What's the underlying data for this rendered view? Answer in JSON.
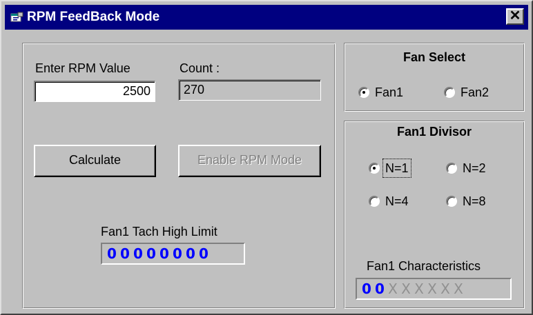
{
  "window": {
    "title": "RPM FeedBack Mode",
    "close_glyph": "✕"
  },
  "left_panel": {
    "rpm_label": "Enter RPM Value",
    "rpm_value": "2500",
    "count_label": "Count :",
    "count_value": "270",
    "calculate_label": "Calculate",
    "enable_rpm_label": "Enable RPM Mode",
    "tach_label": "Fan1 Tach High Limit",
    "tach_digits": [
      "0",
      "0",
      "0",
      "0",
      "0",
      "0",
      "0",
      "0"
    ]
  },
  "fan_select": {
    "title": "Fan Select",
    "options": [
      {
        "label": "Fan1",
        "selected": true
      },
      {
        "label": "Fan2",
        "selected": false
      }
    ]
  },
  "fan_divisor": {
    "title": "Fan1 Divisor",
    "options": [
      {
        "label": "N=1",
        "selected": true
      },
      {
        "label": "N=2",
        "selected": false
      },
      {
        "label": "N=4",
        "selected": false
      },
      {
        "label": "N=8",
        "selected": false
      }
    ],
    "char_label": "Fan1 Characteristics",
    "char_digits": [
      "0",
      "0",
      "X",
      "X",
      "X",
      "X",
      "X",
      "X"
    ]
  },
  "colors": {
    "titlebar": "#000080",
    "face": "#c0c0c0",
    "digit_active": "#0000ff",
    "digit_inactive": "#909090"
  },
  "icons": {
    "title_icon": "app-icon",
    "close_icon": "close-icon"
  }
}
